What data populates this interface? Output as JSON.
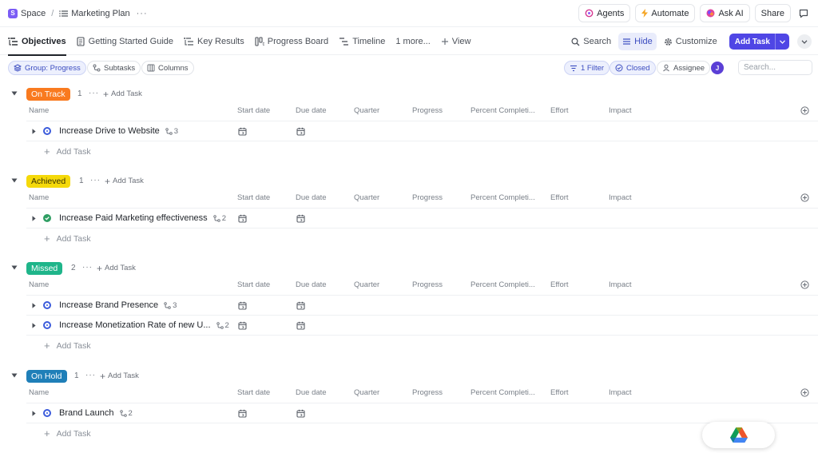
{
  "breadcrumb": {
    "space": "Space",
    "space_initial": "S",
    "separator": "/",
    "list": "Marketing Plan",
    "more": "···"
  },
  "topbar": {
    "agents": "Agents",
    "automate": "Automate",
    "ask_ai": "Ask AI",
    "share": "Share"
  },
  "tabs": [
    {
      "label": "Objectives",
      "icon": "list-icon",
      "active": true
    },
    {
      "label": "Getting Started Guide",
      "icon": "doc-icon",
      "active": false
    },
    {
      "label": "Key Results",
      "icon": "list-icon",
      "active": false
    },
    {
      "label": "Progress Board",
      "icon": "board-icon",
      "active": false
    },
    {
      "label": "Timeline",
      "icon": "timeline-icon",
      "active": false
    },
    {
      "label": "1 more...",
      "icon": "",
      "active": false
    },
    {
      "label": "View",
      "icon": "plus-icon",
      "active": false
    }
  ],
  "tools": {
    "search": "Search",
    "hide": "Hide",
    "customize": "Customize",
    "add_task": "Add Task"
  },
  "filters": {
    "group": "Group: Progress",
    "subtasks": "Subtasks",
    "columns": "Columns",
    "filter": "1 Filter",
    "closed": "Closed",
    "assignee": "Assignee",
    "avatar_initial": "J",
    "search_placeholder": "Search..."
  },
  "columns": [
    "Name",
    "Start date",
    "Due date",
    "Quarter",
    "Progress",
    "Percent Completi...",
    "Effort",
    "Impact"
  ],
  "groups": [
    {
      "status": "On Track",
      "count": "1",
      "add_label": "Add Task",
      "pill_bg": "#f97a1f",
      "pill_fg": "#ffffff",
      "tasks": [
        {
          "name": "Increase Drive to Website",
          "subtasks": "3",
          "status_icon": "in-progress"
        }
      ],
      "add_row": "Add Task"
    },
    {
      "status": "Achieved",
      "count": "1",
      "add_label": "Add Task",
      "pill_bg": "#f5d90a",
      "pill_fg": "#3a3300",
      "tasks": [
        {
          "name": "Increase Paid Marketing effectiveness",
          "subtasks": "2",
          "status_icon": "complete"
        }
      ],
      "add_row": "Add Task"
    },
    {
      "status": "Missed",
      "count": "2",
      "add_label": "Add Task",
      "pill_bg": "#1fb58a",
      "pill_fg": "#ffffff",
      "tasks": [
        {
          "name": "Increase Brand Presence",
          "subtasks": "3",
          "status_icon": "in-progress"
        },
        {
          "name": "Increase Monetization Rate of new U...",
          "subtasks": "2",
          "status_icon": "in-progress"
        }
      ],
      "add_row": "Add Task"
    },
    {
      "status": "On Hold",
      "count": "1",
      "add_label": "Add Task",
      "pill_bg": "#1f7fb8",
      "pill_fg": "#ffffff",
      "tasks": [
        {
          "name": "Brand Launch",
          "subtasks": "2",
          "status_icon": "in-progress"
        }
      ],
      "add_row": "Add Task"
    }
  ],
  "colors": {
    "accent": "#4f46e5",
    "in_progress": "#3b5bdb",
    "complete": "#2f9e63"
  }
}
